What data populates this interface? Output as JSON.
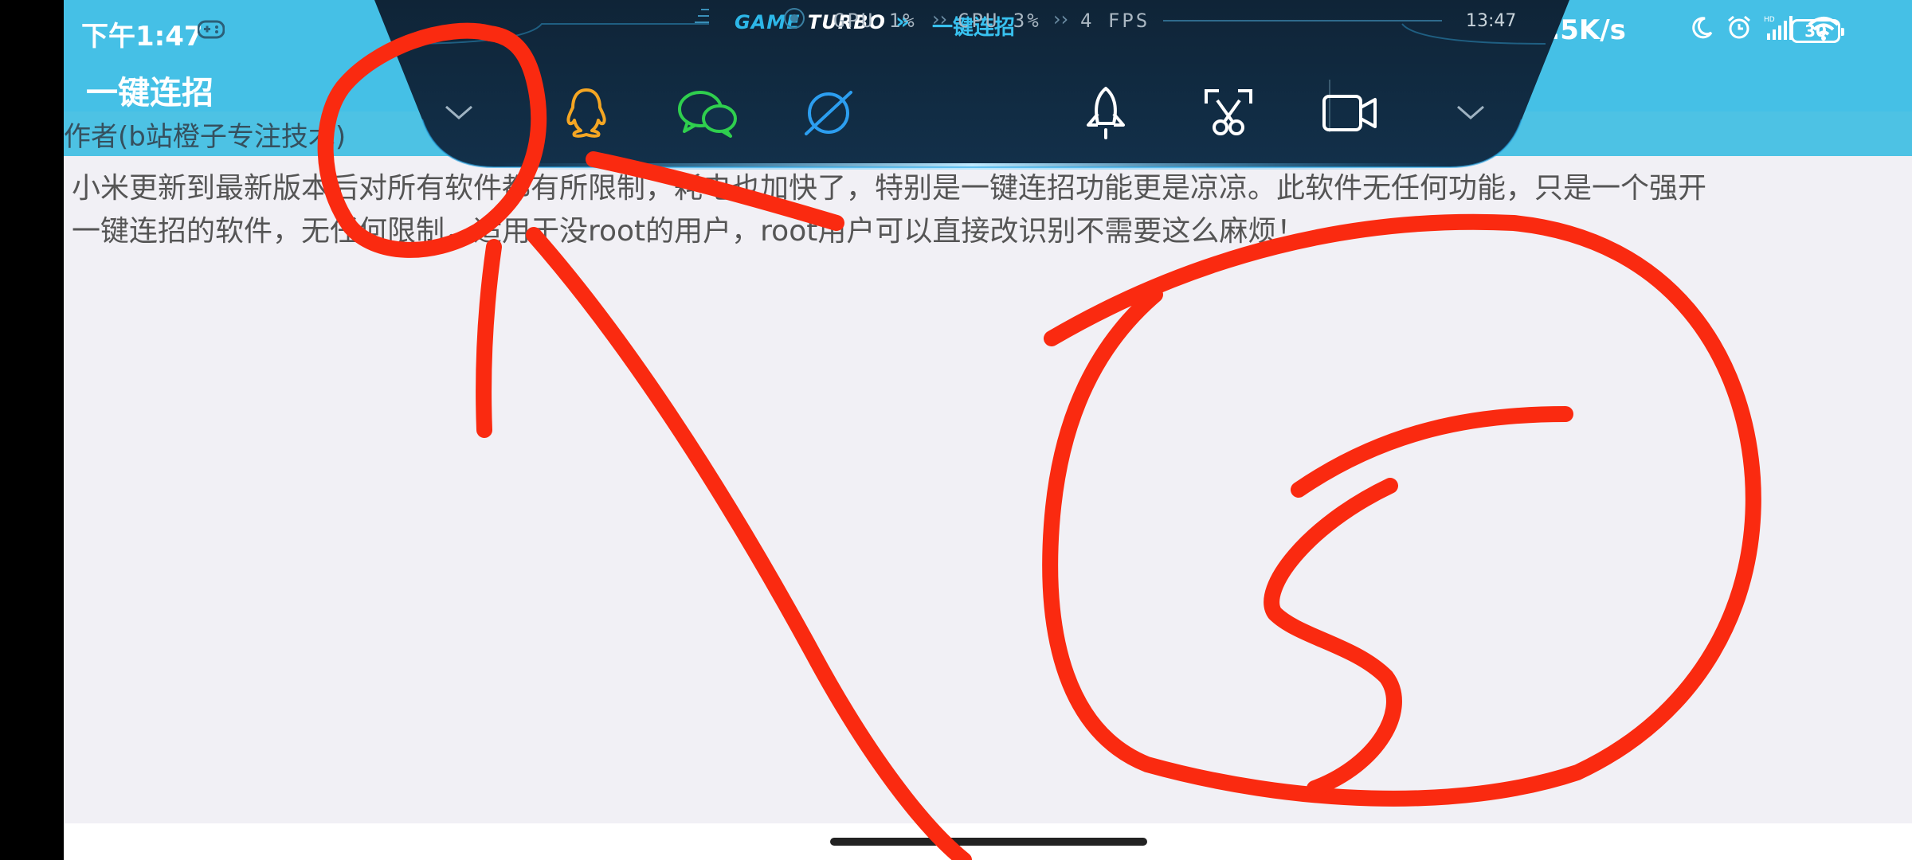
{
  "status_bar": {
    "time": "下午1:47",
    "net_speed": "29.5K/s",
    "battery": "30"
  },
  "app": {
    "title": "一键连招",
    "author": "作者(b站橙子专注技术)",
    "description": "小米更新到最新版本后对所有软件都有所限制，耗电也加快了，特别是一键连招功能更是凉凉。此软件无任何功能，只是一个强开\n一键连招的软件，无任何限制，适用于没root的用户，root用户可以直接改识别不需要这么麻烦！"
  },
  "game_turbo": {
    "brand_prefix": "GAME",
    "brand_suffix": "TURBO",
    "chevrons": "»",
    "app_name": "一键连招",
    "gpu": "GPU 1%",
    "cpu": "CPU 3%",
    "fps": "4 FPS",
    "separator": "››",
    "clock": "13:47",
    "toolbar_icons": [
      "chevron-down-icon",
      "qq-icon",
      "wechat-icon",
      "browser-icon",
      "rocket-icon",
      "screenshot-icon",
      "video-record-icon",
      "chevron-down-icon"
    ]
  },
  "colors": {
    "app_bar": "#45c0e6",
    "panel_bg": "#10263a",
    "qq": "#f5a623",
    "wechat": "#2fcf4e",
    "browser": "#2c9ef0",
    "annotation": "#fa2a10"
  }
}
